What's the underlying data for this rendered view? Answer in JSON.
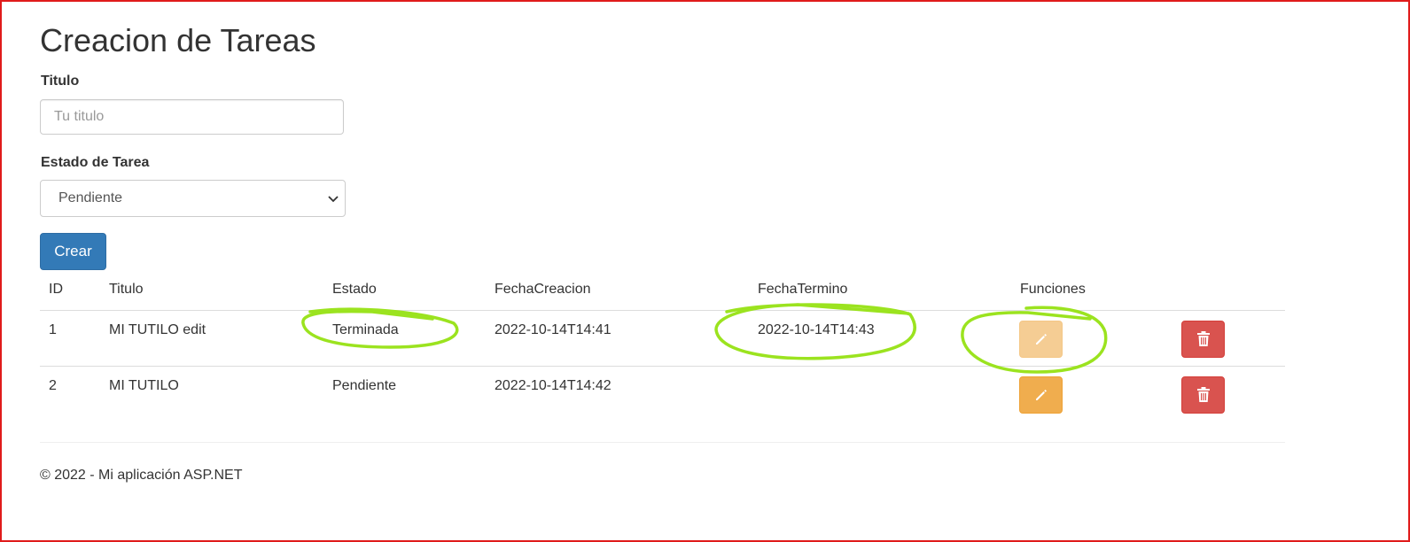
{
  "page": {
    "title": "Creacion de Tareas",
    "footer": "© 2022 - Mi aplicación ASP.NET"
  },
  "form": {
    "titulo_label": "Titulo",
    "titulo_placeholder": "Tu titulo",
    "titulo_value": "",
    "estado_label": "Estado de Tarea",
    "estado_selected": "Pendiente",
    "submit_label": "Crear"
  },
  "table": {
    "headers": [
      "ID",
      "Titulo",
      "Estado",
      "FechaCreacion",
      "FechaTermino",
      "Funciones"
    ],
    "rows": [
      {
        "id": "1",
        "titulo": "MI TUTILO edit",
        "estado": "Terminada",
        "fecha_creacion": "2022-10-14T14:41",
        "fecha_termino": "2022-10-14T14:43",
        "edit_icon": "pencil-icon",
        "delete_icon": "trash-icon",
        "edit_disabled": true
      },
      {
        "id": "2",
        "titulo": "MI TUTILO",
        "estado": "Pendiente",
        "fecha_creacion": "2022-10-14T14:42",
        "fecha_termino": "",
        "edit_icon": "pencil-icon",
        "delete_icon": "trash-icon",
        "edit_disabled": false
      }
    ]
  },
  "colors": {
    "primary": "#337ab7",
    "warning": "#f0ad4e",
    "danger": "#d9534f",
    "annotation": "#9be31f",
    "frame": "#e01b1b"
  }
}
